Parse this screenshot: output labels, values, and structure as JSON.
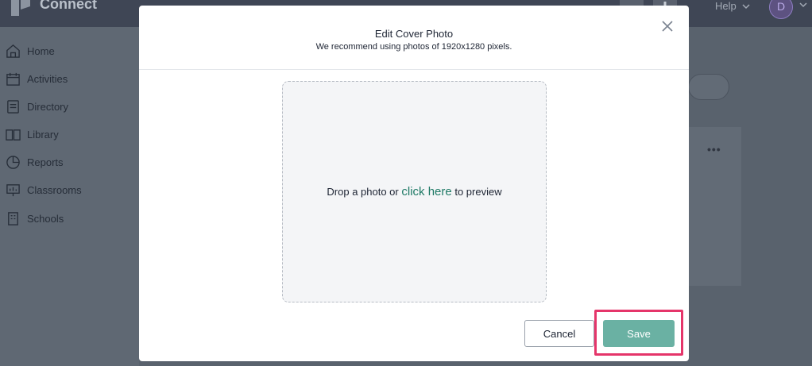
{
  "app": {
    "brand": "Connect",
    "help_label": "Help",
    "avatar_initial": "D"
  },
  "sidebar": {
    "items": [
      {
        "label": "Home",
        "icon": "home-icon"
      },
      {
        "label": "Activities",
        "icon": "calendar-icon"
      },
      {
        "label": "Directory",
        "icon": "directory-icon"
      },
      {
        "label": "Library",
        "icon": "book-icon"
      },
      {
        "label": "Reports",
        "icon": "pie-chart-icon"
      },
      {
        "label": "Classrooms",
        "icon": "presentation-icon"
      },
      {
        "label": "Schools",
        "icon": "building-icon"
      }
    ]
  },
  "modal": {
    "title": "Edit Cover Photo",
    "subtitle": "We recommend using photos of 1920x1280 pixels.",
    "close_icon": "close-icon",
    "dropzone": {
      "prefix": "Drop a photo or ",
      "link": "click here",
      "suffix": " to preview"
    },
    "cancel_label": "Cancel",
    "save_label": "Save"
  },
  "colors": {
    "overlay": "#5d6673",
    "accent_link": "#1f7a66",
    "save_button": "#6ab1a3",
    "highlight": "#e5356a"
  }
}
